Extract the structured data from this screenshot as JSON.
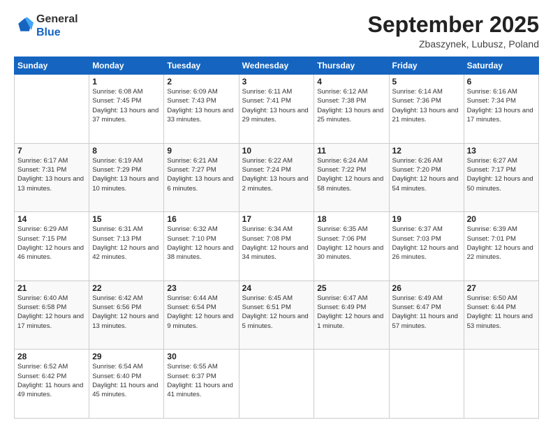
{
  "logo": {
    "general": "General",
    "blue": "Blue"
  },
  "header": {
    "title": "September 2025",
    "location": "Zbaszynek, Lubusz, Poland"
  },
  "weekdays": [
    "Sunday",
    "Monday",
    "Tuesday",
    "Wednesday",
    "Thursday",
    "Friday",
    "Saturday"
  ],
  "weeks": [
    [
      {
        "day": "",
        "info": ""
      },
      {
        "day": "1",
        "info": "Sunrise: 6:08 AM\nSunset: 7:45 PM\nDaylight: 13 hours\nand 37 minutes."
      },
      {
        "day": "2",
        "info": "Sunrise: 6:09 AM\nSunset: 7:43 PM\nDaylight: 13 hours\nand 33 minutes."
      },
      {
        "day": "3",
        "info": "Sunrise: 6:11 AM\nSunset: 7:41 PM\nDaylight: 13 hours\nand 29 minutes."
      },
      {
        "day": "4",
        "info": "Sunrise: 6:12 AM\nSunset: 7:38 PM\nDaylight: 13 hours\nand 25 minutes."
      },
      {
        "day": "5",
        "info": "Sunrise: 6:14 AM\nSunset: 7:36 PM\nDaylight: 13 hours\nand 21 minutes."
      },
      {
        "day": "6",
        "info": "Sunrise: 6:16 AM\nSunset: 7:34 PM\nDaylight: 13 hours\nand 17 minutes."
      }
    ],
    [
      {
        "day": "7",
        "info": "Sunrise: 6:17 AM\nSunset: 7:31 PM\nDaylight: 13 hours\nand 13 minutes."
      },
      {
        "day": "8",
        "info": "Sunrise: 6:19 AM\nSunset: 7:29 PM\nDaylight: 13 hours\nand 10 minutes."
      },
      {
        "day": "9",
        "info": "Sunrise: 6:21 AM\nSunset: 7:27 PM\nDaylight: 13 hours\nand 6 minutes."
      },
      {
        "day": "10",
        "info": "Sunrise: 6:22 AM\nSunset: 7:24 PM\nDaylight: 13 hours\nand 2 minutes."
      },
      {
        "day": "11",
        "info": "Sunrise: 6:24 AM\nSunset: 7:22 PM\nDaylight: 12 hours\nand 58 minutes."
      },
      {
        "day": "12",
        "info": "Sunrise: 6:26 AM\nSunset: 7:20 PM\nDaylight: 12 hours\nand 54 minutes."
      },
      {
        "day": "13",
        "info": "Sunrise: 6:27 AM\nSunset: 7:17 PM\nDaylight: 12 hours\nand 50 minutes."
      }
    ],
    [
      {
        "day": "14",
        "info": "Sunrise: 6:29 AM\nSunset: 7:15 PM\nDaylight: 12 hours\nand 46 minutes."
      },
      {
        "day": "15",
        "info": "Sunrise: 6:31 AM\nSunset: 7:13 PM\nDaylight: 12 hours\nand 42 minutes."
      },
      {
        "day": "16",
        "info": "Sunrise: 6:32 AM\nSunset: 7:10 PM\nDaylight: 12 hours\nand 38 minutes."
      },
      {
        "day": "17",
        "info": "Sunrise: 6:34 AM\nSunset: 7:08 PM\nDaylight: 12 hours\nand 34 minutes."
      },
      {
        "day": "18",
        "info": "Sunrise: 6:35 AM\nSunset: 7:06 PM\nDaylight: 12 hours\nand 30 minutes."
      },
      {
        "day": "19",
        "info": "Sunrise: 6:37 AM\nSunset: 7:03 PM\nDaylight: 12 hours\nand 26 minutes."
      },
      {
        "day": "20",
        "info": "Sunrise: 6:39 AM\nSunset: 7:01 PM\nDaylight: 12 hours\nand 22 minutes."
      }
    ],
    [
      {
        "day": "21",
        "info": "Sunrise: 6:40 AM\nSunset: 6:58 PM\nDaylight: 12 hours\nand 17 minutes."
      },
      {
        "day": "22",
        "info": "Sunrise: 6:42 AM\nSunset: 6:56 PM\nDaylight: 12 hours\nand 13 minutes."
      },
      {
        "day": "23",
        "info": "Sunrise: 6:44 AM\nSunset: 6:54 PM\nDaylight: 12 hours\nand 9 minutes."
      },
      {
        "day": "24",
        "info": "Sunrise: 6:45 AM\nSunset: 6:51 PM\nDaylight: 12 hours\nand 5 minutes."
      },
      {
        "day": "25",
        "info": "Sunrise: 6:47 AM\nSunset: 6:49 PM\nDaylight: 12 hours\nand 1 minute."
      },
      {
        "day": "26",
        "info": "Sunrise: 6:49 AM\nSunset: 6:47 PM\nDaylight: 11 hours\nand 57 minutes."
      },
      {
        "day": "27",
        "info": "Sunrise: 6:50 AM\nSunset: 6:44 PM\nDaylight: 11 hours\nand 53 minutes."
      }
    ],
    [
      {
        "day": "28",
        "info": "Sunrise: 6:52 AM\nSunset: 6:42 PM\nDaylight: 11 hours\nand 49 minutes."
      },
      {
        "day": "29",
        "info": "Sunrise: 6:54 AM\nSunset: 6:40 PM\nDaylight: 11 hours\nand 45 minutes."
      },
      {
        "day": "30",
        "info": "Sunrise: 6:55 AM\nSunset: 6:37 PM\nDaylight: 11 hours\nand 41 minutes."
      },
      {
        "day": "",
        "info": ""
      },
      {
        "day": "",
        "info": ""
      },
      {
        "day": "",
        "info": ""
      },
      {
        "day": "",
        "info": ""
      }
    ]
  ]
}
